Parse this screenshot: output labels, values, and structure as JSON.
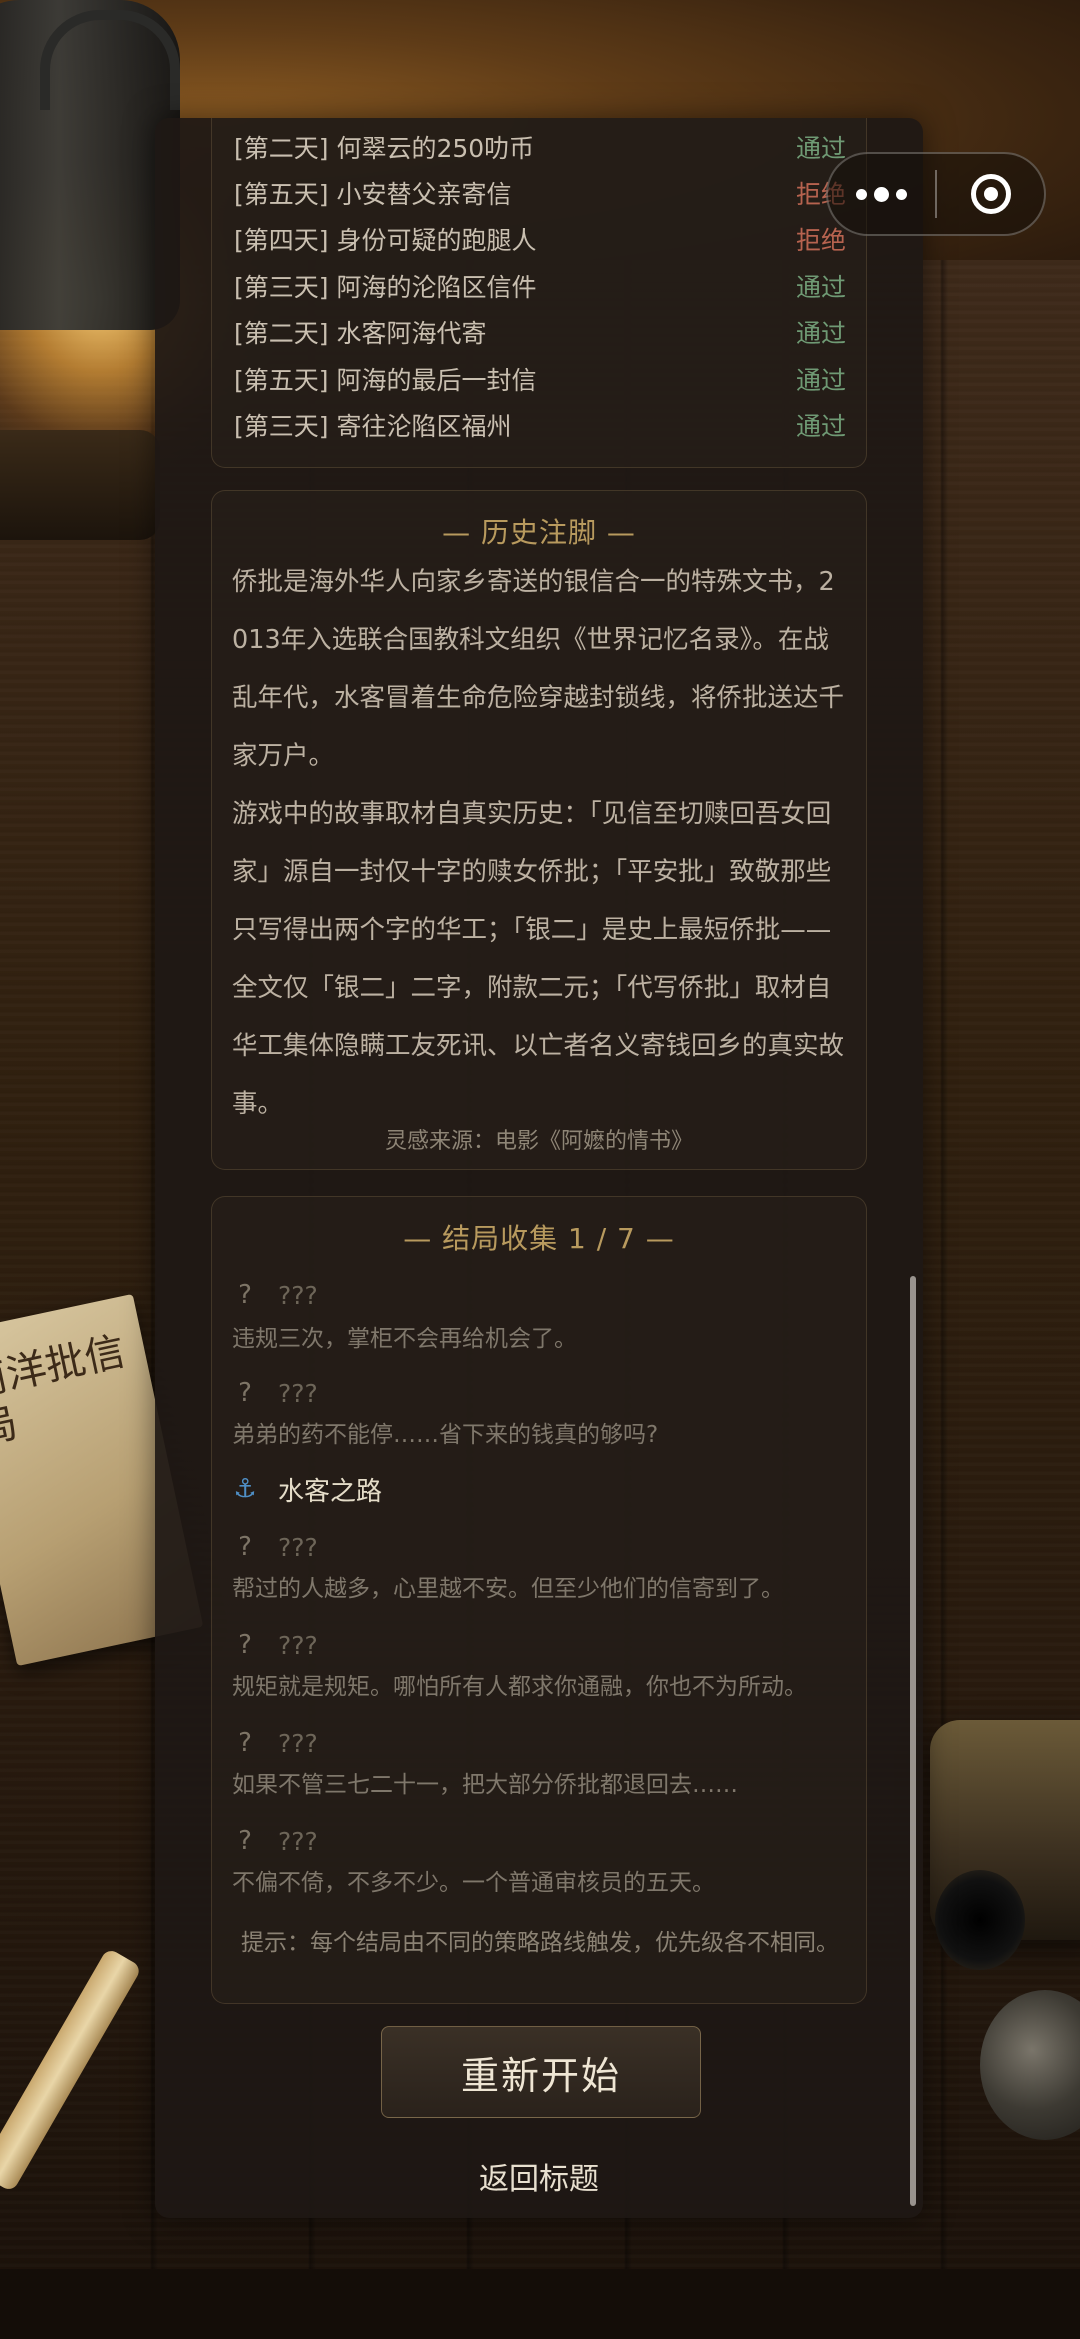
{
  "decision_log": [
    {
      "title": "[第二天] 何翠云的250叻币",
      "status": "通过",
      "kind": "pass"
    },
    {
      "title": "[第五天] 小安替父亲寄信",
      "status": "拒绝",
      "kind": "reject"
    },
    {
      "title": "[第四天] 身份可疑的跑腿人",
      "status": "拒绝",
      "kind": "reject"
    },
    {
      "title": "[第三天] 阿海的沦陷区信件",
      "status": "通过",
      "kind": "pass"
    },
    {
      "title": "[第二天] 水客阿海代寄",
      "status": "通过",
      "kind": "pass"
    },
    {
      "title": "[第五天] 阿海的最后一封信",
      "status": "通过",
      "kind": "pass"
    },
    {
      "title": "[第三天] 寄往沦陷区福州",
      "status": "通过",
      "kind": "pass"
    }
  ],
  "history": {
    "heading": "— 历史注脚 —",
    "paragraph1": "侨批是海外华人向家乡寄送的银信合一的特殊文书，2013年入选联合国教科文组织《世界记忆名录》。在战乱年代，水客冒着生命危险穿越封锁线，将侨批送达千家万户。",
    "paragraph2": "游戏中的故事取材自真实历史：「见信至切赎回吾女回家」源自一封仅十字的赎女侨批；「平安批」致敬那些只写得出两个字的华工；「银二」是史上最短侨批——全文仅「银二」二字，附款二元；「代写侨批」取材自华工集体隐瞒工友死讯、以亡者名义寄钱回乡的真实故事。",
    "source": "灵感来源：电影《阿嬷的情书》"
  },
  "endings": {
    "heading": "— 结局收集 1 / 7 —",
    "items": [
      {
        "icon": "?",
        "title": "???",
        "desc": "违规三次，掌柜不会再给机会了。",
        "unlocked": false
      },
      {
        "icon": "?",
        "title": "???",
        "desc": "弟弟的药不能停……省下来的钱真的够吗?",
        "unlocked": false
      },
      {
        "icon": "⚓",
        "title": "水客之路",
        "desc": "",
        "unlocked": true
      },
      {
        "icon": "?",
        "title": "???",
        "desc": "帮过的人越多，心里越不安。但至少他们的信寄到了。",
        "unlocked": false
      },
      {
        "icon": "?",
        "title": "???",
        "desc": "规矩就是规矩。哪怕所有人都求你通融，你也不为所动。",
        "unlocked": false
      },
      {
        "icon": "?",
        "title": "???",
        "desc": "如果不管三七二十一，把大部分侨批都退回去……",
        "unlocked": false
      },
      {
        "icon": "?",
        "title": "???",
        "desc": "不偏不倚，不多不少。一个普通审核员的五天。",
        "unlocked": false
      }
    ],
    "hint": "提示：每个结局由不同的策略路线触发，优先级各不相同。"
  },
  "buttons": {
    "restart": "重新开始",
    "back_to_title": "返回标题"
  },
  "decor": {
    "envelope_text": "南洋批信局"
  },
  "colors": {
    "pass": "#6f9a74",
    "reject": "#b7634f",
    "heading_gold": "#b89a5e",
    "anchor_blue": "#4f8fc6"
  }
}
